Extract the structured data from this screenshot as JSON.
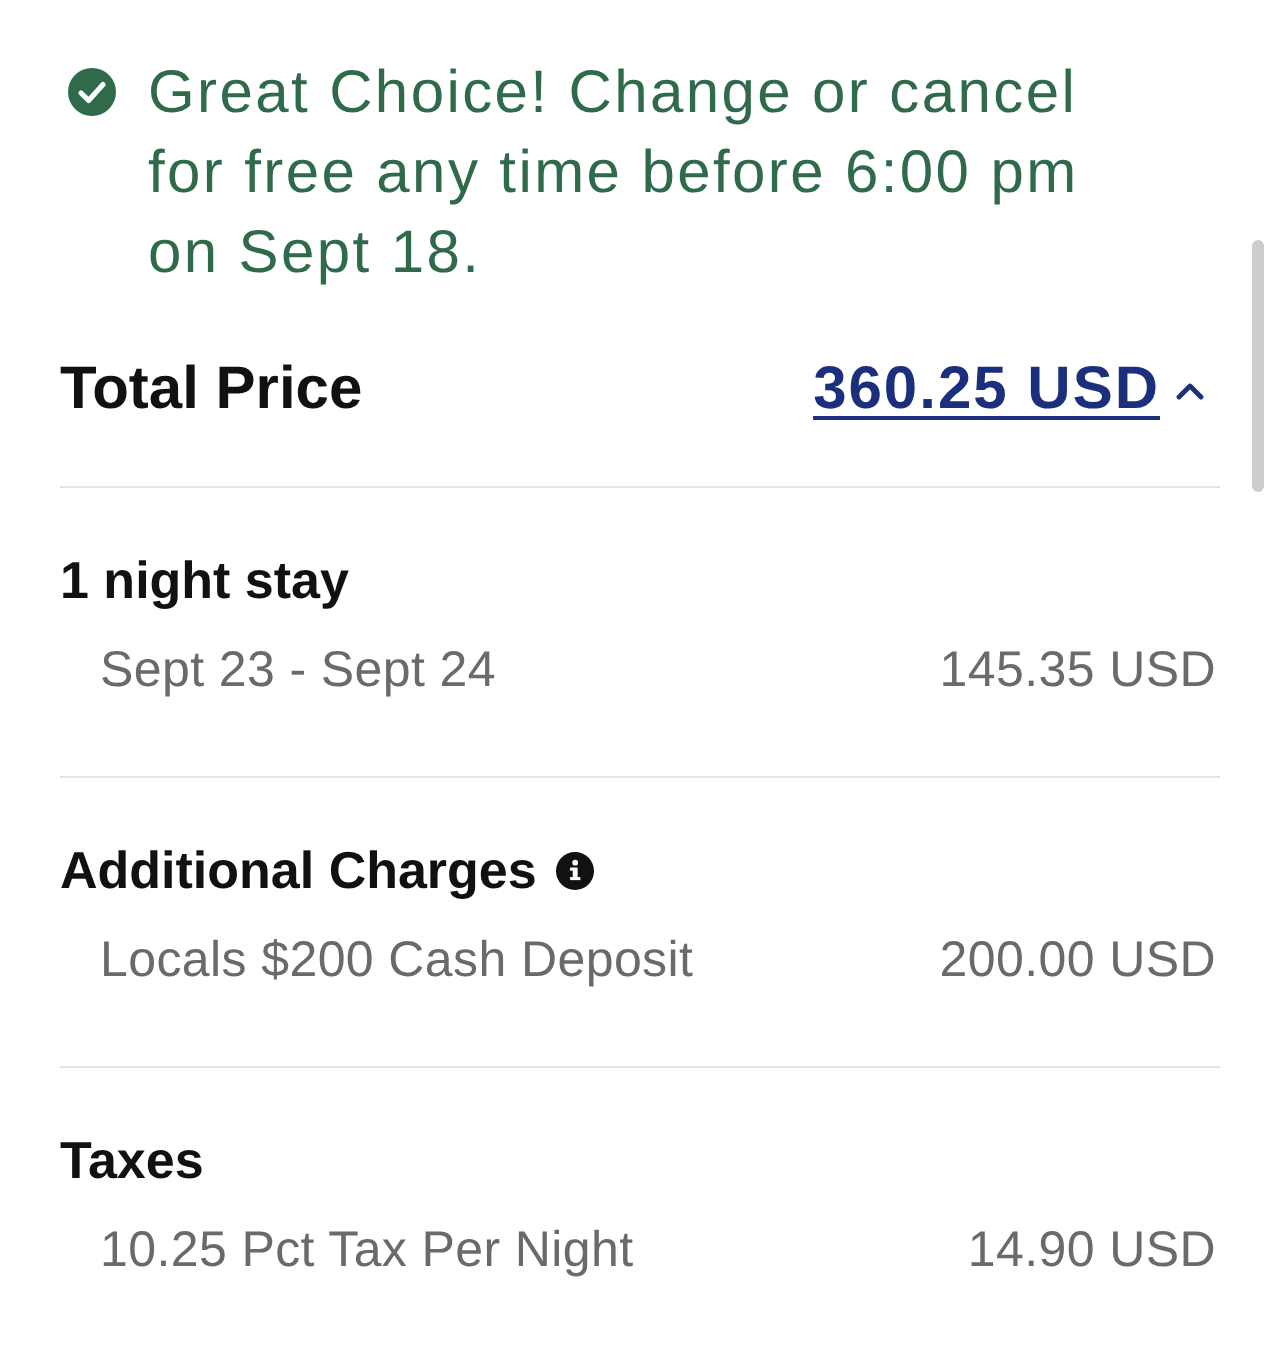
{
  "notice": {
    "text": "Great Choice! Change or cancel for free any time before 6:00 pm on Sept 18."
  },
  "total": {
    "label": "Total Price",
    "amount": "360.25 USD",
    "expanded": true
  },
  "sections": [
    {
      "title": "1 night stay",
      "info": false,
      "items": [
        {
          "label": "Sept 23 - Sept 24",
          "amount": "145.35 USD"
        }
      ]
    },
    {
      "title": "Additional Charges",
      "info": true,
      "items": [
        {
          "label": "Locals $200 Cash Deposit",
          "amount": "200.00 USD"
        }
      ]
    },
    {
      "title": "Taxes",
      "info": false,
      "items": [
        {
          "label": "10.25 Pct Tax Per Night",
          "amount": "14.90 USD"
        }
      ]
    }
  ]
}
